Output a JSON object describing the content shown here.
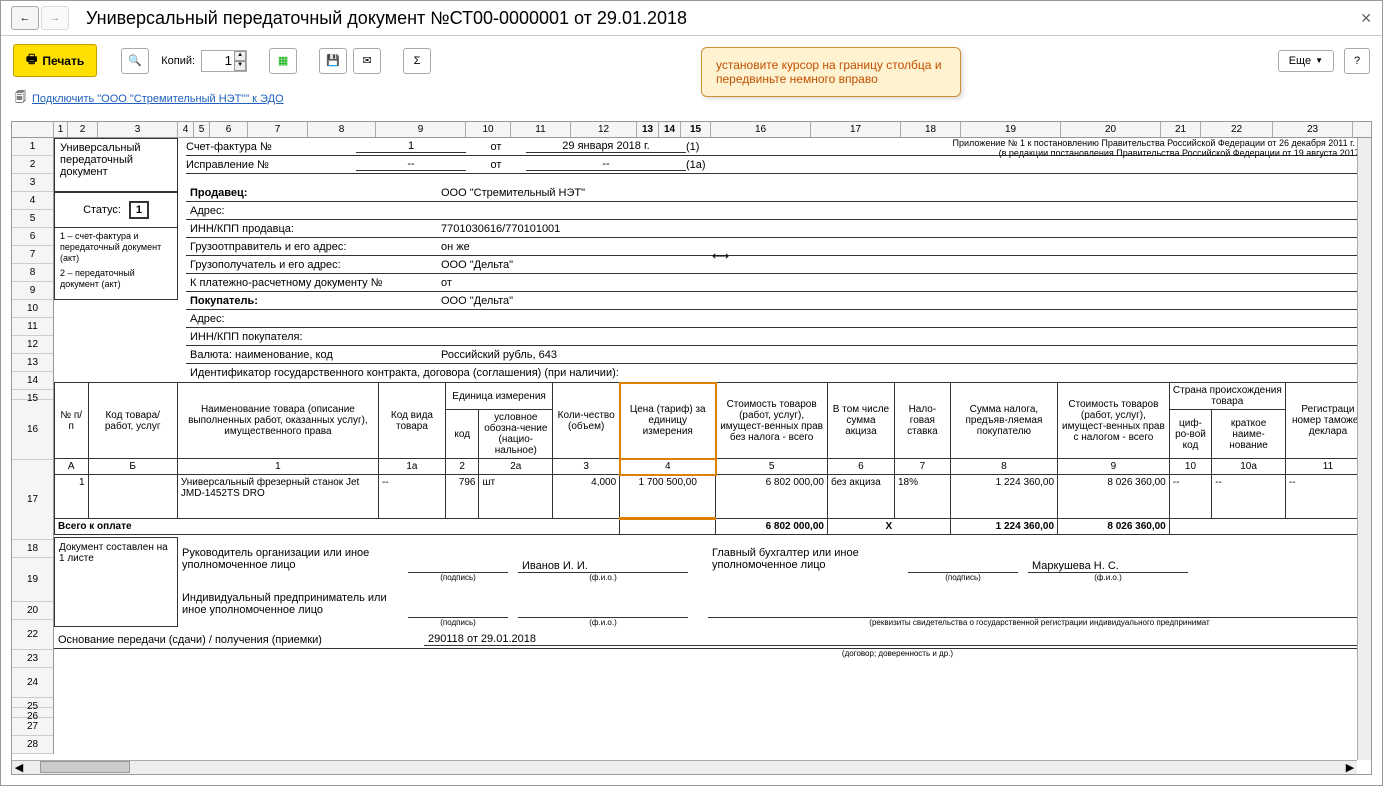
{
  "window": {
    "title": "Универсальный передаточный документ №СТ00-0000001 от 29.01.2018"
  },
  "toolbar": {
    "print": "Печать",
    "copies_label": "Копий:",
    "copies_value": "1",
    "more": "Еще"
  },
  "edo": {
    "link": "Подключить \"ООО \"Стремительный НЭТ\"\" к ЭДО"
  },
  "callout": {
    "text": "установите курсор на границу столбца и передвиньте немного вправо"
  },
  "ruler": [
    "1",
    "2",
    "3",
    "4",
    "5",
    "6",
    "7",
    "8",
    "9",
    "10",
    "11",
    "12",
    "13",
    "14",
    "15",
    "16",
    "17",
    "18",
    "19",
    "20",
    "21",
    "22",
    "23"
  ],
  "rows": [
    "1",
    "2",
    "3",
    "4",
    "5",
    "6",
    "7",
    "8",
    "9",
    "10",
    "11",
    "12",
    "13",
    "14",
    "15",
    "16",
    "17",
    "18",
    "19",
    "20",
    "22",
    "23",
    "24",
    "25",
    "26",
    "27",
    "28"
  ],
  "univ": {
    "line1": "Универсальный",
    "line2": "передаточный",
    "line3": "документ",
    "status_label": "Статус:",
    "status_value": "1",
    "legend1": "1 – счет-фактура и передаточный документ (акт)",
    "legend2": "2 – передаточный документ (акт)"
  },
  "invoice": {
    "sf_label": "Счет-фактура №",
    "sf_num": "1",
    "from": "от",
    "sf_date": "29 января 2018 г.",
    "sf_code": "(1)",
    "corr_label": "Исправление №",
    "corr_num": "--",
    "corr_date": "--",
    "corr_code": "(1а)",
    "note1": "Приложение № 1 к постановлению Правительства Российской Федерации от 26 декабря 2011 г. №",
    "note2": "(в редакции постановления Правительства Российской Федерации от 19 августа 2017 г."
  },
  "fields": {
    "seller_l": "Продавец:",
    "seller_v": "ООО \"Стремительный НЭТ\"",
    "addr_l": "Адрес:",
    "addr_v": "",
    "inn_l": "ИНН/КПП продавца:",
    "inn_v": "7701030616/770101001",
    "ship_l": "Грузоотправитель и его адрес:",
    "ship_v": "он же",
    "recv_l": "Грузополучатель и его адрес:",
    "recv_v": "ООО \"Дельта\"",
    "pay_l": "К платежно-расчетному документу №",
    "pay_v": "от",
    "buyer_l": "Покупатель:",
    "buyer_v": "ООО \"Дельта\"",
    "baddr_l": "Адрес:",
    "baddr_v": "",
    "binn_l": "ИНН/КПП покупателя:",
    "binn_v": "",
    "curr_l": "Валюта: наименование, код",
    "curr_v": "Российский рубль, 643",
    "gos_l": "Идентификатор государственного контракта, договора (соглашения) (при наличии):"
  },
  "thead": {
    "c1": "№ п/п",
    "c2": "Код товара/ работ, услуг",
    "c3": "Наименование товара (описание выполненных работ, оказанных услуг), имущественного права",
    "c4": "Код вида товара",
    "c5": "Единица измерения",
    "c5a": "код",
    "c5b": "условное обозна-чение (нацио-нальное)",
    "c6": "Коли-чество (объем)",
    "c7": "Цена (тариф) за единицу измерения",
    "c8": "Стоимость товаров (работ, услуг), имущест-венных прав без налога - всего",
    "c9": "В том числе сумма акциза",
    "c10": "Нало-говая ставка",
    "c11": "Сумма налога, предъяв-ляемая покупателю",
    "c12": "Стоимость товаров (работ, услуг), имущест-венных прав с налогом - всего",
    "c13": "Страна происхождения товара",
    "c13a": "циф-ро-вой код",
    "c13b": "краткое наиме-нование",
    "c14": "Регистраци номер таможен деклара"
  },
  "subhead": {
    "a": "А",
    "b": "Б",
    "1": "1",
    "1a": "1а",
    "2": "2",
    "2a": "2а",
    "3": "3",
    "4": "4",
    "5": "5",
    "6": "6",
    "7": "7",
    "8": "8",
    "9": "9",
    "10": "10",
    "10a": "10а",
    "11": "11"
  },
  "item": {
    "n": "1",
    "code": "",
    "name": "Универсальный фрезерный станок Jet JMD-1452TS DRO",
    "vid": "--",
    "ucode": "796",
    "uname": "шт",
    "qty": "4,000",
    "price": "1 700 500,00",
    "sum": "6 802 000,00",
    "acciz": "без акциза",
    "rate": "18%",
    "tax": "1 224 360,00",
    "total": "8 026 360,00",
    "ccode": "--",
    "cname": "--",
    "decl": "--"
  },
  "totals": {
    "label": "Всего к оплате",
    "sum": "6 802 000,00",
    "x": "X",
    "tax": "1 224 360,00",
    "total": "8 026 360,00"
  },
  "sig": {
    "doc": "Документ составлен на 1 листе",
    "head": "Руководитель организации или иное уполномоченное лицо",
    "sign": "(подпись)",
    "fio": "(ф.и.о.)",
    "head_fio": "Иванов И. И.",
    "acc": "Главный бухгалтер или иное уполномоченное лицо",
    "acc_fio": "Маркушева Н. С.",
    "ip": "Индивидуальный предприниматель или иное уполномоченное лицо",
    "rekv": "(реквизиты свидетельства о государственной  регистрации индивидуального предпринимат"
  },
  "base": {
    "label": "Основание передачи (сдачи) / получения (приемки)",
    "value": "290118 от 29.01.2018",
    "sub": "(договор; доверенность и др.)"
  }
}
